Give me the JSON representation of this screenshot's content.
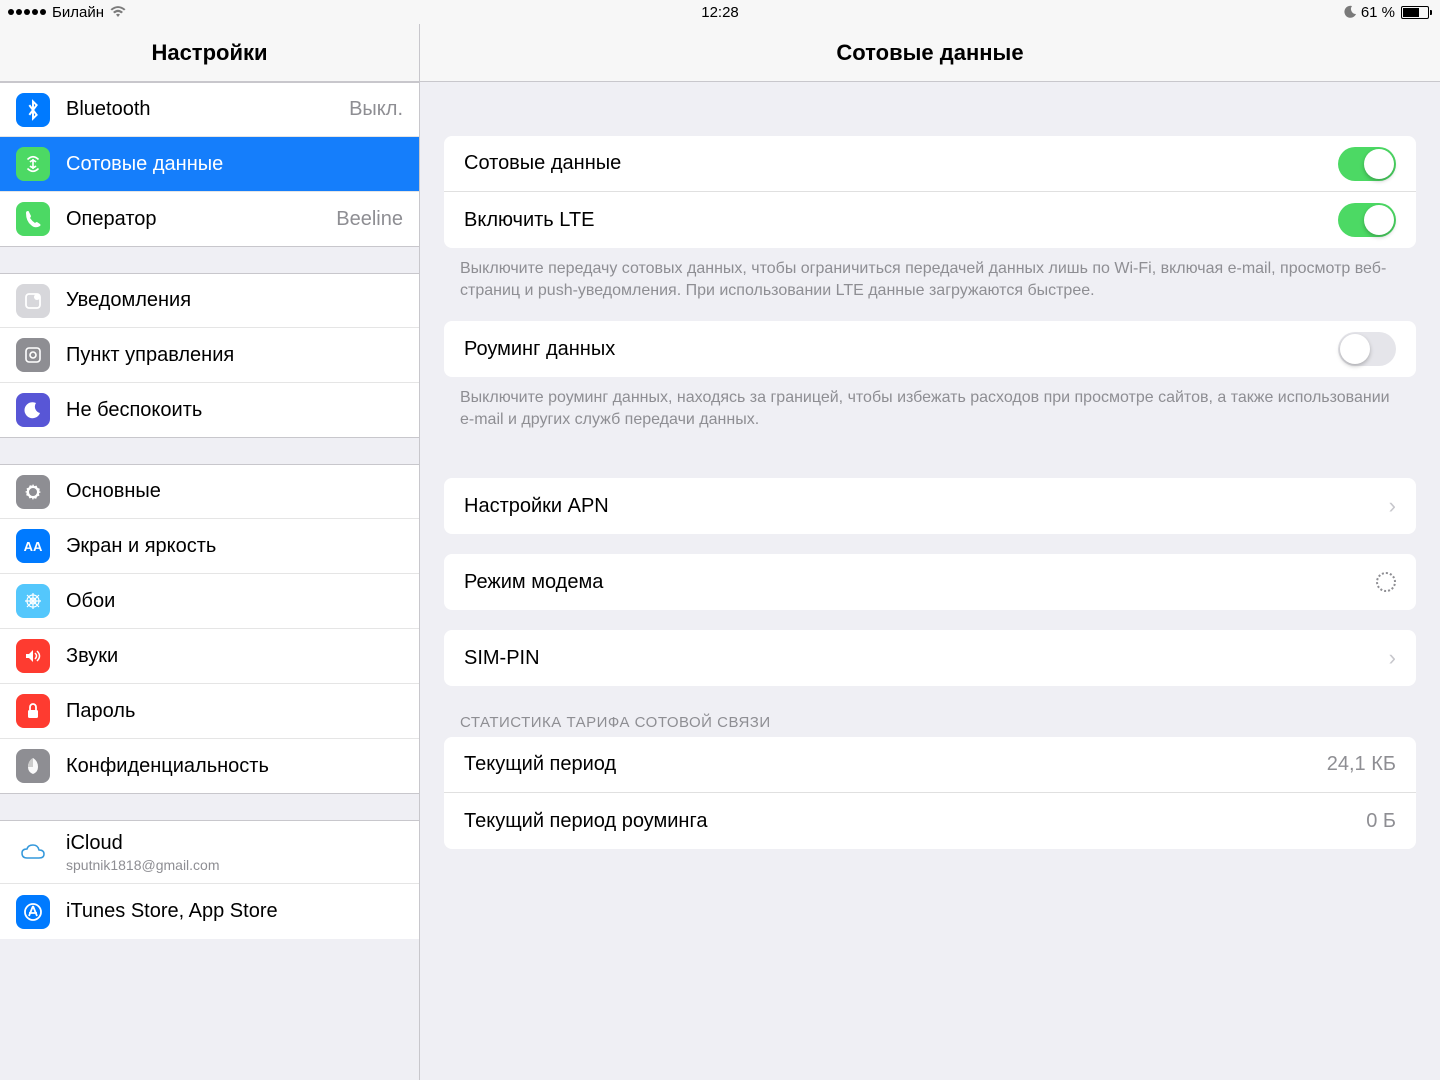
{
  "status": {
    "carrier": "Билайн",
    "time": "12:28",
    "battery": "61 %"
  },
  "sidebar": {
    "title": "Настройки",
    "groups": [
      {
        "items": [
          {
            "icon": "bluetooth-icon",
            "color": "ic-bt",
            "label": "Bluetooth",
            "value": "Выкл."
          },
          {
            "icon": "cellular-icon",
            "color": "ic-cell",
            "label": "Сотовые данные",
            "selected": true
          },
          {
            "icon": "phone-icon",
            "color": "ic-carr",
            "label": "Оператор",
            "value": "Beeline"
          }
        ]
      },
      {
        "items": [
          {
            "icon": "notifications-icon",
            "color": "ic-notif",
            "label": "Уведомления"
          },
          {
            "icon": "control-center-icon",
            "color": "ic-cc",
            "label": "Пункт управления"
          },
          {
            "icon": "dnd-icon",
            "color": "ic-dnd",
            "label": "Не беспокоить"
          }
        ]
      },
      {
        "items": [
          {
            "icon": "gear-icon",
            "color": "ic-gen",
            "label": "Основные"
          },
          {
            "icon": "display-icon",
            "color": "ic-disp",
            "label": "Экран и яркость"
          },
          {
            "icon": "wallpaper-icon",
            "color": "ic-wall",
            "label": "Обои"
          },
          {
            "icon": "sounds-icon",
            "color": "ic-snd",
            "label": "Звуки"
          },
          {
            "icon": "passcode-icon",
            "color": "ic-pass",
            "label": "Пароль"
          },
          {
            "icon": "privacy-icon",
            "color": "ic-priv",
            "label": "Конфиденциальность"
          }
        ]
      },
      {
        "items": [
          {
            "icon": "icloud-icon",
            "color": "ic-cloud",
            "label": "iCloud",
            "sub": "sputnik1818@gmail.com",
            "tall": true
          },
          {
            "icon": "appstore-icon",
            "color": "ic-store",
            "label": "iTunes Store, App Store"
          }
        ]
      }
    ]
  },
  "detail": {
    "title": "Сотовые данные",
    "g1": {
      "cellular_label": "Сотовые данные",
      "cellular_on": true,
      "lte_label": "Включить LTE",
      "lte_on": true,
      "note": "Выключите передачу сотовых данных, чтобы ограничиться передачей данных лишь по Wi-Fi, включая e-mail, просмотр веб-страниц и push-уведомления. При использовании LTE данные загружаются быстрее."
    },
    "g2": {
      "roaming_label": "Роуминг данных",
      "roaming_on": false,
      "note": "Выключите роуминг данных, находясь за границей, чтобы избежать расходов при просмотре сайтов, а также использовании e-mail и других служб передачи данных."
    },
    "g3": {
      "apn_label": "Настройки APN"
    },
    "g4": {
      "hotspot_label": "Режим модема"
    },
    "g5": {
      "simpin_label": "SIM-PIN"
    },
    "stats": {
      "header": "СТАТИСТИКА ТАРИФА СОТОВОЙ СВЯЗИ",
      "current_label": "Текущий период",
      "current_value": "24,1 КБ",
      "roaming_label": "Текущий период роуминга",
      "roaming_value": "0 Б"
    }
  }
}
